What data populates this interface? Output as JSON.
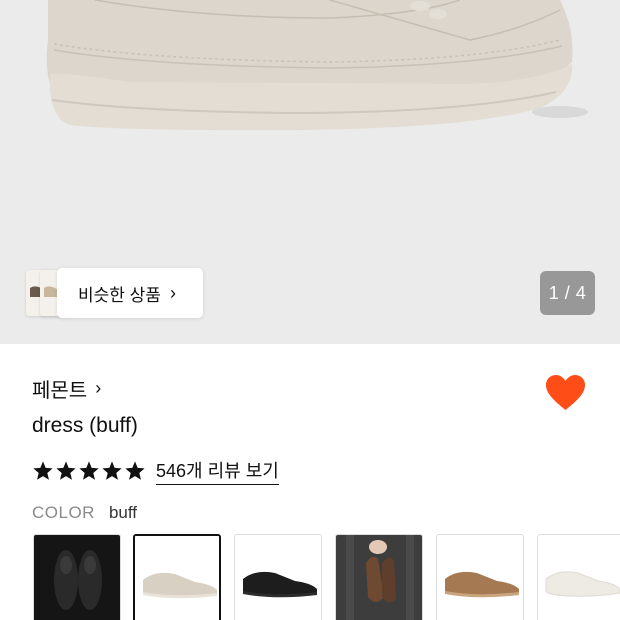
{
  "gallery": {
    "similar_label": "비슷한 상품",
    "chevron": "›",
    "counter": "1 / 4"
  },
  "product": {
    "brand": "페몬트",
    "brand_chevron": "›",
    "name": "dress (buff)",
    "rating_stars": 5,
    "review_link": "546개 리뷰 보기",
    "color_label": "COLOR",
    "color_value": "buff"
  },
  "swatches": [
    {
      "name": "black-pair",
      "selected": false
    },
    {
      "name": "buff",
      "selected": true
    },
    {
      "name": "black",
      "selected": false
    },
    {
      "name": "brown-hand",
      "selected": false
    },
    {
      "name": "tan",
      "selected": false
    },
    {
      "name": "white",
      "selected": false
    }
  ],
  "colors": {
    "heart": "#ff4d17",
    "hero_bg": "#ebebeb",
    "shoe_buff": "#d6d0c6"
  },
  "icons": [
    "heart-icon",
    "star-icon",
    "chevron-right-icon"
  ]
}
